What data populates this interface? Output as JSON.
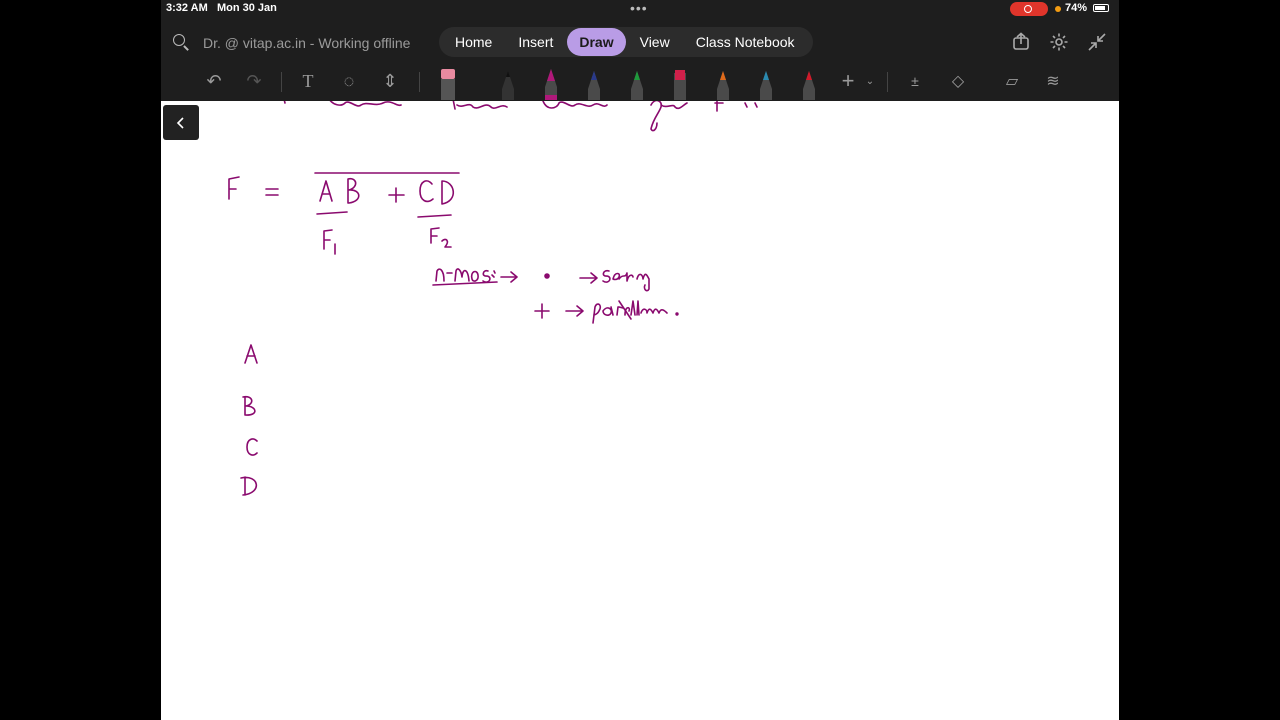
{
  "status_bar": {
    "time": "3:32 AM",
    "date": "Mon 30 Jan",
    "battery": "74%"
  },
  "header": {
    "doc_title": "Dr. @ vitap.ac.in - Working offline",
    "tabs": [
      {
        "label": "Home"
      },
      {
        "label": "Insert"
      },
      {
        "label": "Draw",
        "active": true
      },
      {
        "label": "View"
      },
      {
        "label": "Class Notebook"
      }
    ]
  },
  "ink_text": {
    "top_partial": "... Combine ... them ... common ... gate f ...",
    "equation": "F = AB + CD",
    "f1": "F1",
    "f2": "F2",
    "note1": "n-mos -> · -> Series",
    "note2": "+ -> parallel",
    "inputs": [
      "A",
      "B",
      "C",
      "D"
    ]
  },
  "colors": {
    "accent_tab": "#b99ce6",
    "ink": "#8a0a6e",
    "pen_colors": [
      "#3a3a3a",
      "#b0187a",
      "#2a3a8a",
      "#1f9a3c",
      "#d0204a",
      "#e06a1a",
      "#2a8ab0",
      "#d01a2a"
    ]
  },
  "icons": [
    "search-icon",
    "share-icon",
    "gear-icon",
    "collapse-icon",
    "undo-icon",
    "redo-icon",
    "text-icon",
    "lasso-icon",
    "space-icon",
    "eraser-icon",
    "add-icon",
    "math-icon",
    "shapes-icon",
    "sticker-icon",
    "ink-to-text-icon",
    "back-icon"
  ]
}
